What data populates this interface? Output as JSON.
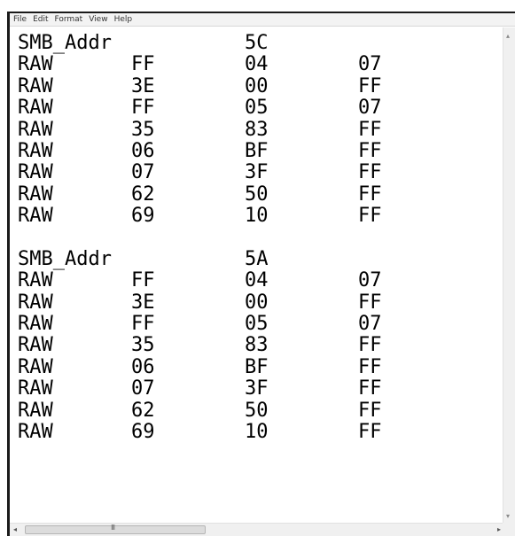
{
  "menu": [
    "File",
    "Edit",
    "Format",
    "View",
    "Help"
  ],
  "lines": [
    [
      "SMB_Addr",
      "",
      "5C",
      ""
    ],
    [
      "RAW",
      "FF",
      "04",
      "07"
    ],
    [
      "RAW",
      "3E",
      "00",
      "FF"
    ],
    [
      "RAW",
      "FF",
      "05",
      "07"
    ],
    [
      "RAW",
      "35",
      "83",
      "FF"
    ],
    [
      "RAW",
      "06",
      "BF",
      "FF"
    ],
    [
      "RAW",
      "07",
      "3F",
      "FF"
    ],
    [
      "RAW",
      "62",
      "50",
      "FF"
    ],
    [
      "RAW",
      "69",
      "10",
      "FF"
    ],
    [
      "",
      "",
      "",
      ""
    ],
    [
      "SMB_Addr",
      "",
      "5A",
      ""
    ],
    [
      "RAW",
      "FF",
      "04",
      "07"
    ],
    [
      "RAW",
      "3E",
      "00",
      "FF"
    ],
    [
      "RAW",
      "FF",
      "05",
      "07"
    ],
    [
      "RAW",
      "35",
      "83",
      "FF"
    ],
    [
      "RAW",
      "06",
      "BF",
      "FF"
    ],
    [
      "RAW",
      "07",
      "3F",
      "FF"
    ],
    [
      "RAW",
      "62",
      "50",
      "FF"
    ],
    [
      "RAW",
      "69",
      "10",
      "FF"
    ]
  ],
  "scrollbar": {
    "left_arrow": "◂",
    "right_arrow": "▸",
    "up_arrow": "▴",
    "down_arrow": "▾",
    "grip": "III"
  }
}
